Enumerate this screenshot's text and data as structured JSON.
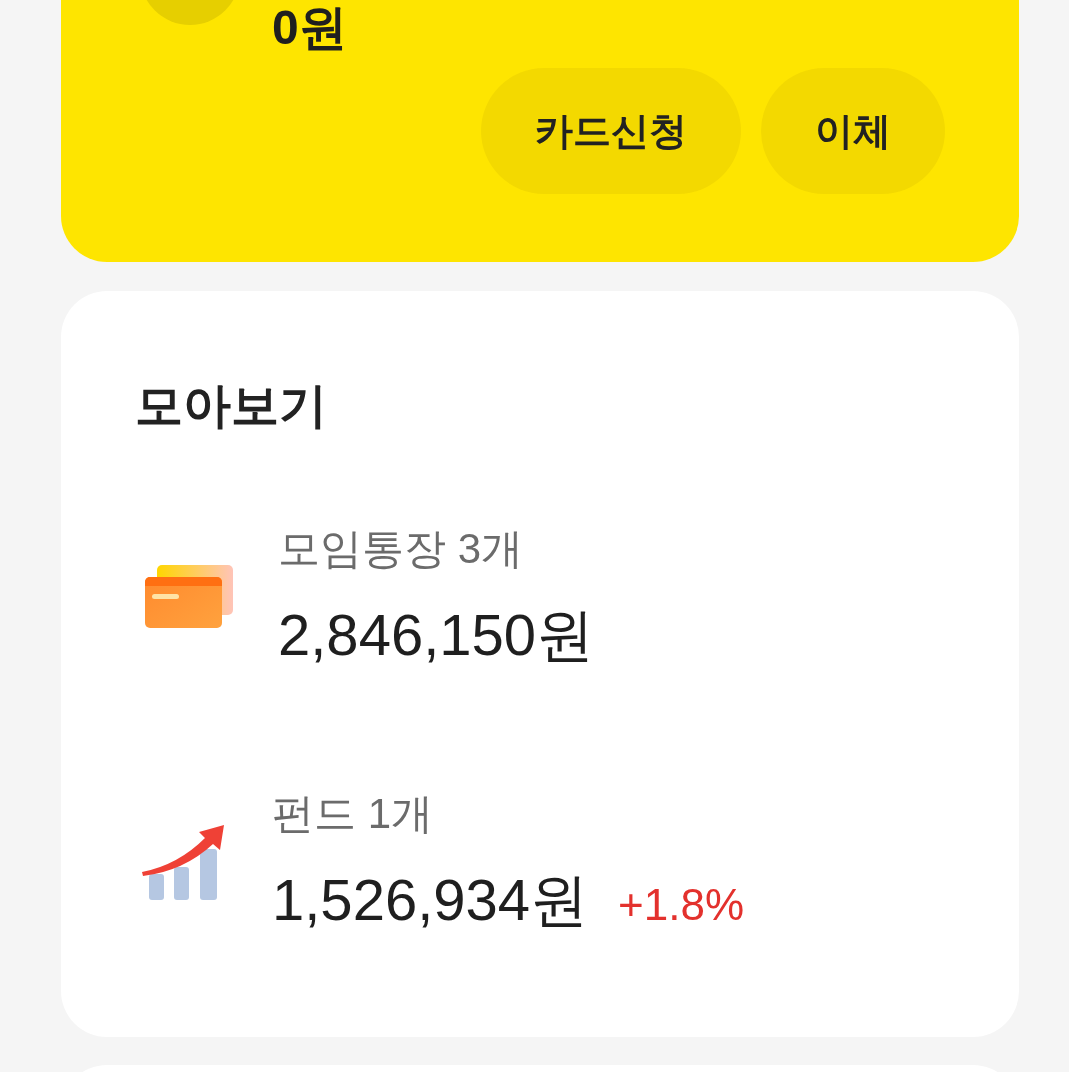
{
  "balance_card": {
    "amount": "0원",
    "buttons": [
      "카드신청",
      "이체"
    ]
  },
  "summary": {
    "title": "모아보기",
    "items": [
      {
        "kind": "account",
        "label": "모임통장 3개",
        "amount": "2,846,150원"
      },
      {
        "kind": "fund",
        "label": "펀드 1개",
        "amount": "1,526,934원",
        "change": "+1.8%"
      }
    ]
  }
}
